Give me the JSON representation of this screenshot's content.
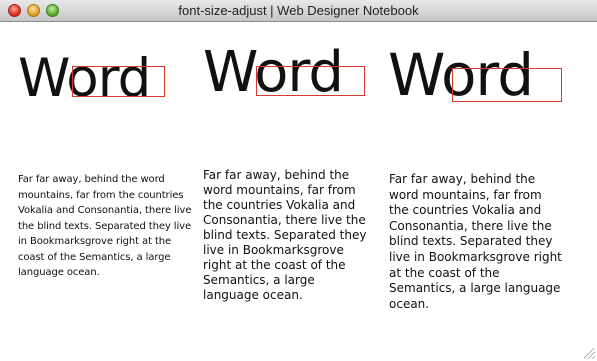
{
  "window": {
    "title": "font-size-adjust | Web Designer Notebook"
  },
  "columns": [
    {
      "word": "Word",
      "paragraph": "Far far away, behind the word mountains, far from the countries Vokalia and Consonantia, there live the blind texts. Separated they live in Bookmarksgrove right at the coast of the Semantics, a large language ocean."
    },
    {
      "word": "Word",
      "paragraph": "Far far away, behind the word mountains, far from the countries Vokalia and Consonantia, there live the blind texts. Separated they live in Bookmarksgrove right at the coast of the Semantics, a large language ocean."
    },
    {
      "word": "Word",
      "paragraph": "Far far away, behind the word mountains, far from the countries Vokalia and Consonantia, there live the blind texts. Separated they live in Bookmarksgrove right at the coast of the Semantics, a large language ocean."
    }
  ],
  "colors": {
    "guide_box": "#d53a32",
    "text": "#111111"
  }
}
